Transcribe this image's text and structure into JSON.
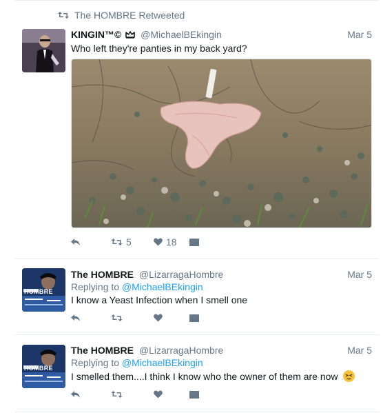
{
  "retweet_banner": {
    "icon": "retweet-icon",
    "text": "The HOMBRE Retweeted"
  },
  "tweets": [
    {
      "name": "KINGIN™©",
      "name_icon": "crown-icon",
      "handle": "@MichaelBEkingin",
      "date": "Mar 5",
      "text": "Who left they're panties in my back yard?",
      "retweets": "5",
      "likes": "18"
    },
    {
      "name": "The HOMBRE",
      "handle": "@LizarragaHombre",
      "date": "Mar 5",
      "replying_label": "Replying to",
      "replying_handle": "@MichaelBEkingin",
      "text": "I know a Yeast Infection when I smell one",
      "avatar_text": "HOMBRE"
    },
    {
      "name": "The HOMBRE",
      "handle": "@LizarragaHombre",
      "date": "Mar 5",
      "replying_label": "Replying to",
      "replying_handle": "@MichaelBEkingin",
      "text": "I smelled them....I think I know who the owner of them are now",
      "emoji": "persevering-face-emoji",
      "avatar_text": "HOMBRE"
    }
  ],
  "icons": {
    "reply": "reply-icon",
    "retweet": "retweet-icon",
    "like": "heart-icon",
    "dm": "envelope-icon"
  },
  "colors": {
    "muted": "#657786",
    "link": "#1da1f2",
    "text": "#14171a"
  }
}
